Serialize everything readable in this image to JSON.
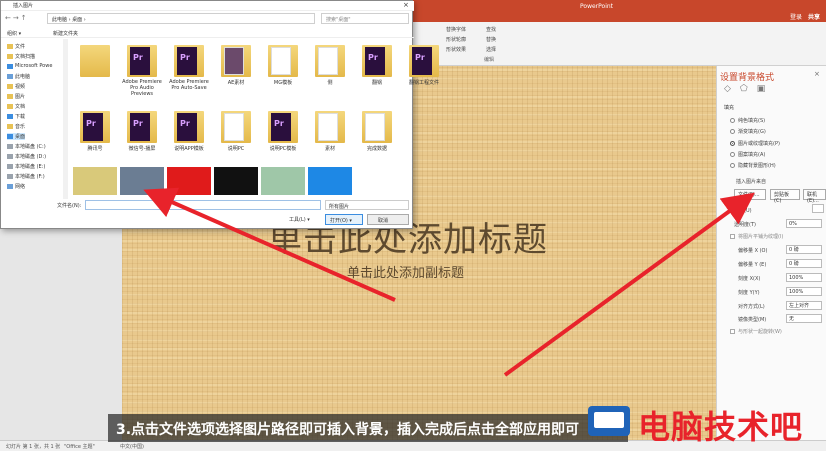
{
  "ppt": {
    "app_title": "PowerPoint",
    "login": "登录",
    "share": "共享"
  },
  "ribbon": {
    "labels": [
      "替换字体",
      "形状轮廓",
      "形状效果",
      "查找",
      "替换",
      "选择",
      "编辑"
    ]
  },
  "slide": {
    "title": "单击此处添加标题",
    "subtitle": "单击此处添加副标题"
  },
  "pane": {
    "title": "设置背景格式",
    "close": "×",
    "section": "填充",
    "fill_options": [
      {
        "label": "纯色填充(S)",
        "selected": false
      },
      {
        "label": "渐变填充(G)",
        "selected": false
      },
      {
        "label": "图片或纹理填充(P)",
        "selected": true
      },
      {
        "label": "图案填充(A)",
        "selected": false
      },
      {
        "label": "隐藏背景图形(H)",
        "selected": false
      }
    ],
    "insert_from": "插入图片来自",
    "file_btn": "文件(F)...",
    "clipboard_btn": "剪贴板(C)",
    "online_btn": "联机(E)...",
    "texture_label": "纹理(U)",
    "transparency_label": "透明度(T)",
    "transparency_value": "0%",
    "tile_check": "将图片平铺为纹理(I)",
    "offset_x_label": "偏移量 X (O)",
    "offset_x_value": "0 磅",
    "offset_y_label": "偏移量 Y (E)",
    "offset_y_value": "0 磅",
    "scale_x_label": "刻度 X(X)",
    "scale_x_value": "100%",
    "scale_y_label": "刻度 Y(Y)",
    "scale_y_value": "100%",
    "align_label": "对齐方式(L)",
    "align_value": "左上对齐",
    "mirror_label": "镜像类型(M)",
    "mirror_value": "无",
    "rotate_check": "与形状一起旋转(W)"
  },
  "status": {
    "slide": "幻灯片 第 1 张，共 1 张",
    "theme": "\"Office 主题\"",
    "lang": "中文(中国)"
  },
  "caption": "3.点击文件选项选择图片路径即可插入背景，插入完成后点击全部应用即可",
  "watermark": "电脑技术吧",
  "dialog": {
    "title": "插入图片",
    "address": "此电脑 › 桌面 ›",
    "search_placeholder": "搜索\"桌面\"",
    "organize": "组织 ▾",
    "new_folder": "新建文件夹",
    "tree": [
      {
        "label": "文件",
        "icon": "folder"
      },
      {
        "label": "文档扫描",
        "icon": "folder"
      },
      {
        "label": "Microsoft Powe",
        "icon": "blue"
      },
      {
        "label": "此电脑",
        "icon": "pc"
      },
      {
        "label": "视频",
        "icon": "folder"
      },
      {
        "label": "图片",
        "icon": "folder"
      },
      {
        "label": "文档",
        "icon": "folder"
      },
      {
        "label": "下载",
        "icon": "blue"
      },
      {
        "label": "音乐",
        "icon": "folder"
      },
      {
        "label": "桌面",
        "icon": "blue",
        "selected": true
      },
      {
        "label": "本地磁盘 (C:)",
        "icon": "drive"
      },
      {
        "label": "本地磁盘 (D:)",
        "icon": "drive"
      },
      {
        "label": "本地磁盘 (E:)",
        "icon": "drive"
      },
      {
        "label": "本地磁盘 (F:)",
        "icon": "drive"
      },
      {
        "label": "网络",
        "icon": "pc"
      }
    ],
    "files": [
      {
        "label": "",
        "kind": "blank"
      },
      {
        "label": "Adobe Premiere Pro Audio Previews",
        "kind": "pr"
      },
      {
        "label": "Adobe Premiere Pro Auto-Save",
        "kind": "pr"
      },
      {
        "label": "AE素材",
        "kind": "ae"
      },
      {
        "label": "MG模板",
        "kind": "doc"
      },
      {
        "label": "侧",
        "kind": "doc"
      },
      {
        "label": "翻锅",
        "kind": "pr"
      },
      {
        "label": "翻锅工程文件",
        "kind": "pr"
      },
      {
        "label": "腾讯号",
        "kind": "pr"
      },
      {
        "label": "微信号-播屏",
        "kind": "pr"
      },
      {
        "label": "说明APP模板",
        "kind": "pr"
      },
      {
        "label": "说明PC",
        "kind": "doc"
      },
      {
        "label": "说明PC模板",
        "kind": "pr"
      },
      {
        "label": "素材",
        "kind": "doc"
      },
      {
        "label": "完成数据",
        "kind": "doc"
      }
    ],
    "thumbs": [
      "#d9c97a",
      "#6b7d93",
      "#e01b1b",
      "#111111",
      "#9fc7a8",
      "#1e88e5"
    ],
    "filename_label": "文件名(N):",
    "filter": "所有图片",
    "tools": "工具(L) ▾",
    "open": "打开(O) ▾",
    "cancel": "取消"
  }
}
